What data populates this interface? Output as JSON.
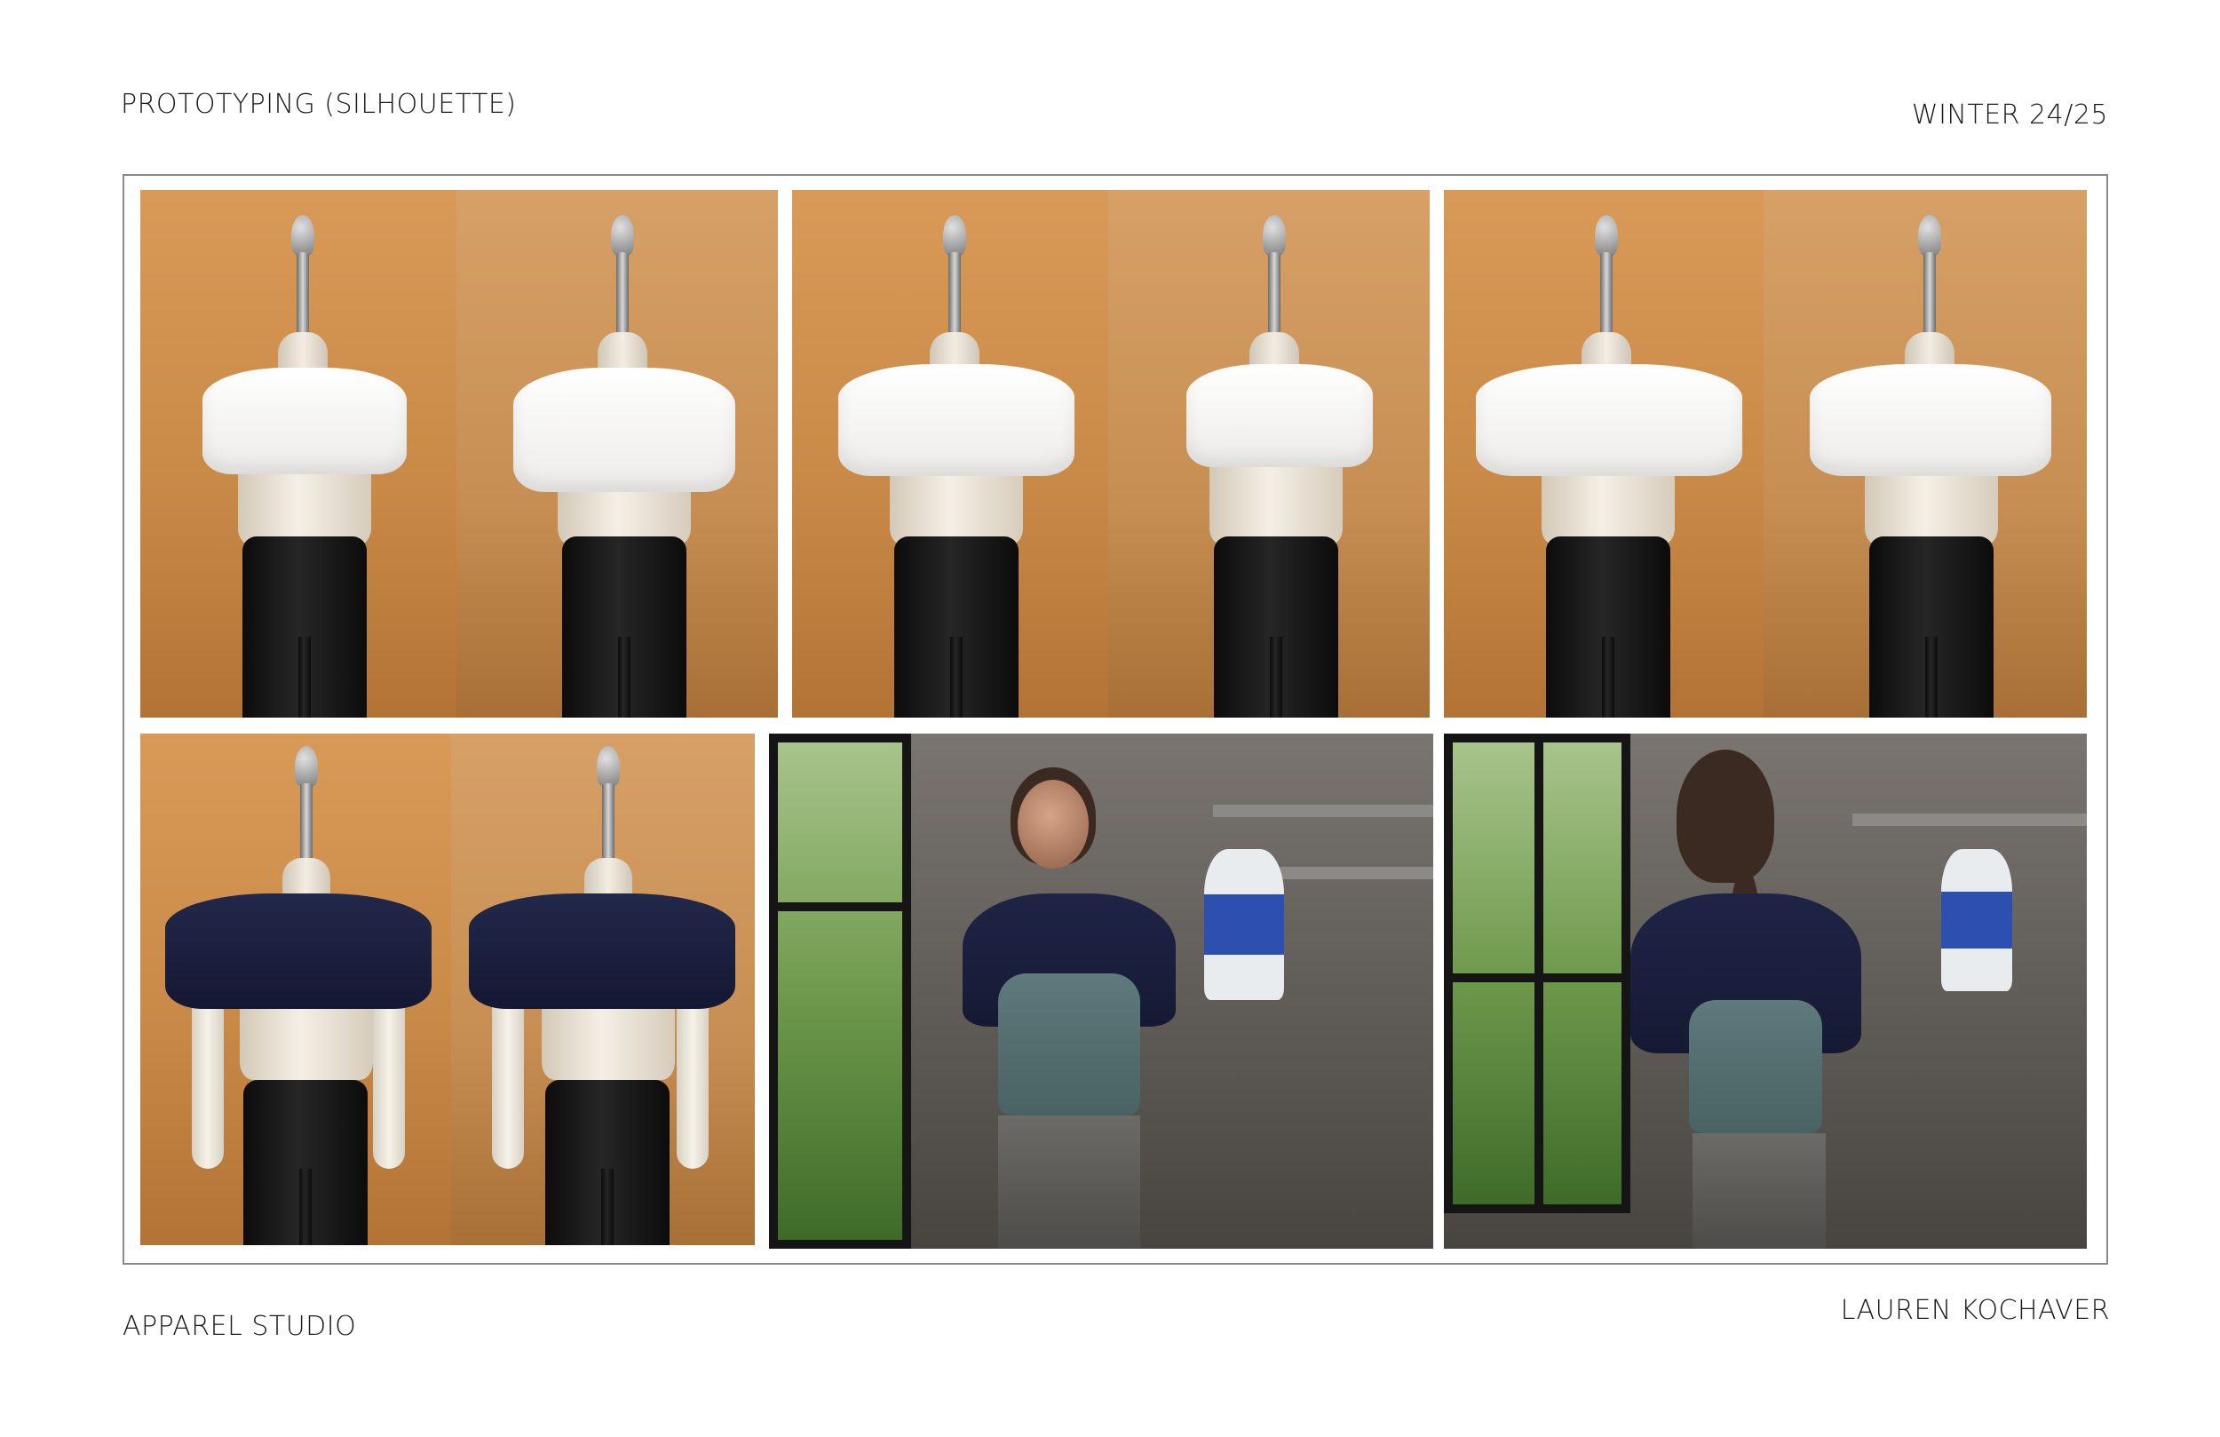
{
  "header": {
    "title": "PROTOTYPING (SILHOUETTE)",
    "season": "WINTER 24/25"
  },
  "footer": {
    "studio": "APPAREL STUDIO",
    "author": "LAUREN KOCHAVER"
  }
}
